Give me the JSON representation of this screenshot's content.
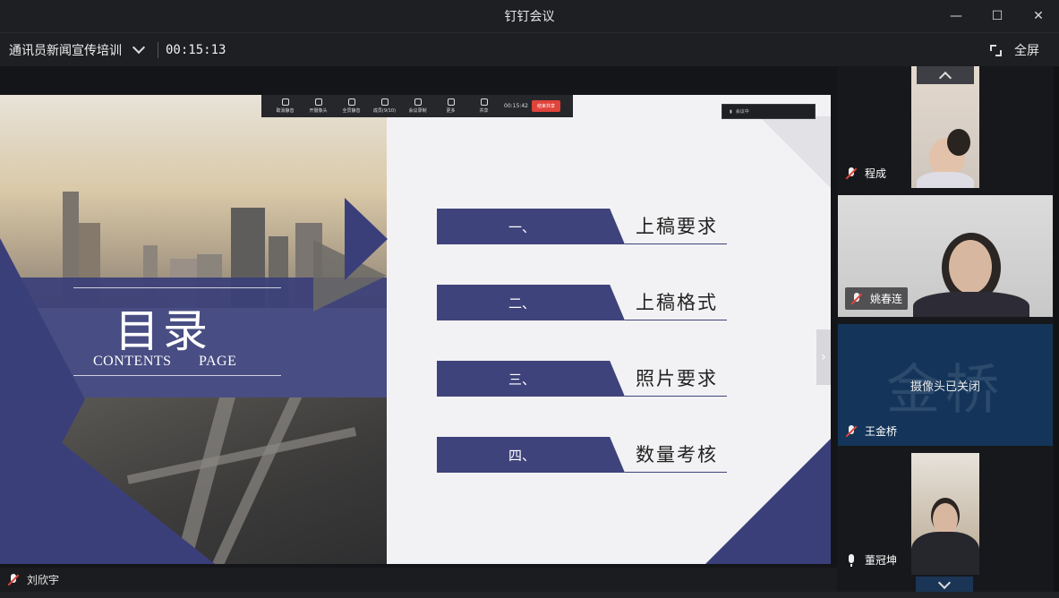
{
  "window": {
    "title": "钉钉会议"
  },
  "info_bar": {
    "meeting_name": "通讯员新闻宣传培训",
    "elapsed": "00:15:13",
    "fullscreen_label": "全屏"
  },
  "slide": {
    "title": "目录",
    "subtitle": "CONTENTS PAGE",
    "items": [
      {
        "num": "一、",
        "text": "上稿要求"
      },
      {
        "num": "二、",
        "text": "上稿格式"
      },
      {
        "num": "三、",
        "text": "照片要求"
      },
      {
        "num": "四、",
        "text": "数量考核"
      }
    ]
  },
  "shared_toolbar": {
    "buttons": [
      "取消静音",
      "开摄像头",
      "全员静音",
      "成员(9/10)",
      "会议录制",
      "更多",
      "共享"
    ],
    "time": "00:15:42",
    "end_label": "结束共享",
    "dropdown_label": "会议中"
  },
  "speaker": {
    "name": "刘欣宇",
    "mic": "muted"
  },
  "participants": [
    {
      "name": "程成",
      "mic": "muted",
      "video": "on"
    },
    {
      "name": "姚春连",
      "mic": "muted",
      "video": "on"
    },
    {
      "name": "王金桥",
      "mic": "muted",
      "video": "off",
      "placeholder_text": "金桥",
      "camera_off_text": "摄像头已关闭"
    },
    {
      "name": "董冠坤",
      "mic": "on",
      "video": "on"
    }
  ]
}
